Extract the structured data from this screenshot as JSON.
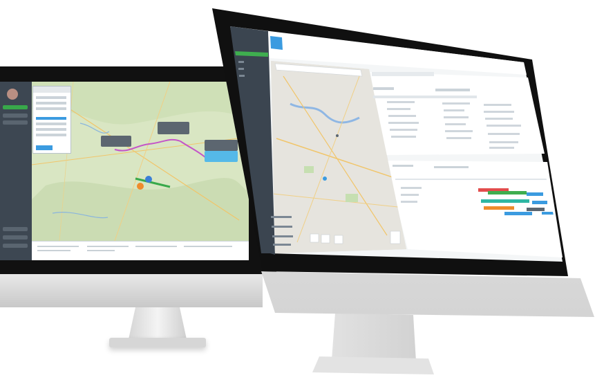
{
  "scene": {
    "back_monitor": {
      "sidebar_items": [
        "",
        "",
        "",
        "",
        ""
      ],
      "map_labels": [
        "",
        "",
        ""
      ]
    },
    "front_monitor": {
      "app_icon": "map-app-icon",
      "sidebar_icons": [
        "menu-icon",
        "dashboard-icon",
        "map-icon",
        "settings-icon",
        "user-icon"
      ],
      "bottom_icons": [
        "globe-icon",
        "layers-icon",
        "ruler-icon"
      ]
    }
  },
  "colors": {
    "sidebar": "#3b4550",
    "accent_green": "#3fae4f",
    "accent_blue": "#3b9be0",
    "timeline_red": "#e24c4c",
    "timeline_orange": "#ef8b2c",
    "timeline_teal": "#2fb7a4"
  },
  "timeline_bars": [
    {
      "color": "#e24c4c",
      "label": ""
    },
    {
      "color": "#3fae4f",
      "label": ""
    },
    {
      "color": "#2fb7a4",
      "label": ""
    },
    {
      "color": "#ef8b2c",
      "label": ""
    },
    {
      "color": "#3b9be0",
      "label": ""
    }
  ]
}
